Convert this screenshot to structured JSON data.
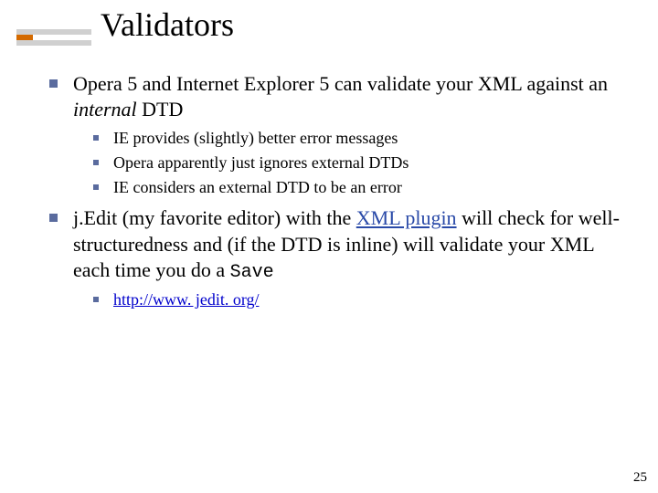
{
  "title": "Validators",
  "bullets": {
    "b1_pre": "Opera 5 and Internet Explorer 5 can validate your XML against an ",
    "b1_em": "internal",
    "b1_post": " DTD",
    "b1_subs": [
      "IE provides (slightly) better error messages",
      "Opera apparently just ignores external DTDs",
      "IE considers an external DTD to be an error"
    ],
    "b2_pre": "j.Edit (my favorite editor) with the ",
    "b2_link": "XML plugin",
    "b2_mid": " will check for well-structuredness and (if the DTD is inline) will validate your XML each time you do a ",
    "b2_code": "Save",
    "b2_subs_link": "http://www. jedit. org/"
  },
  "page_number": "25"
}
